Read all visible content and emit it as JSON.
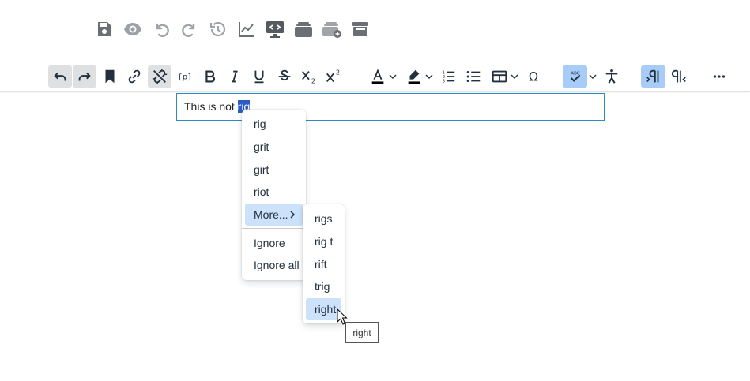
{
  "editor": {
    "text_before": "This is not ",
    "misspelled_word": "rig"
  },
  "context_menu": {
    "suggestions": [
      "rig",
      "grit",
      "girt",
      "riot"
    ],
    "more_label": "More...",
    "ignore_label": "Ignore",
    "ignore_all_label": "Ignore all"
  },
  "submenu": {
    "items": [
      "rigs",
      "rig t",
      "rift",
      "trig",
      "right"
    ]
  },
  "tooltip": {
    "text": "right"
  },
  "colors": {
    "accent": "#2d8ac7",
    "selection": "#2b5cc4",
    "menu_highlight": "#cce2fa",
    "toggle_active": "#a6ccf7",
    "icon": "#222f3e"
  }
}
